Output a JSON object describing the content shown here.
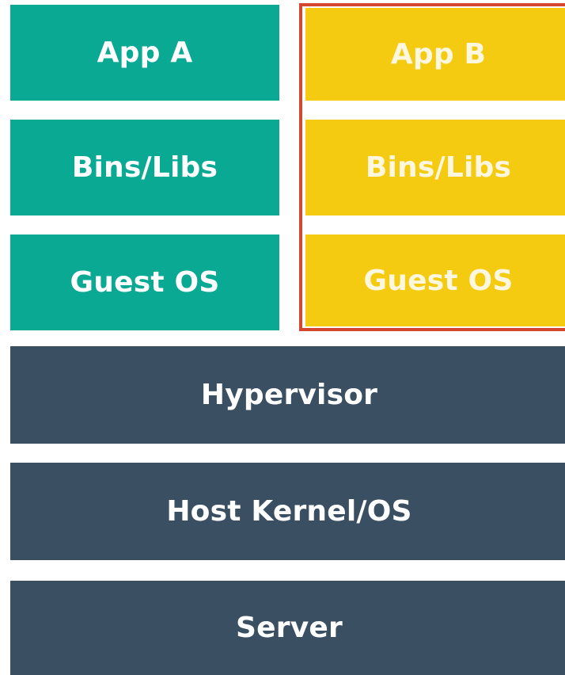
{
  "vm_a": {
    "app": "App A",
    "bins": "Bins/Libs",
    "os": "Guest OS"
  },
  "vm_b": {
    "app": "App B",
    "bins": "Bins/Libs",
    "os": "Guest OS"
  },
  "layers": {
    "hypervisor": "Hypervisor",
    "host_kernel": "Host Kernel/OS",
    "server": "Server"
  },
  "colors": {
    "vm_a": "#0aa993",
    "vm_b": "#f4cb10",
    "vm_b_highlight_border": "#d4472e",
    "infrastructure": "#3a4f61",
    "background": "#ffffff"
  }
}
